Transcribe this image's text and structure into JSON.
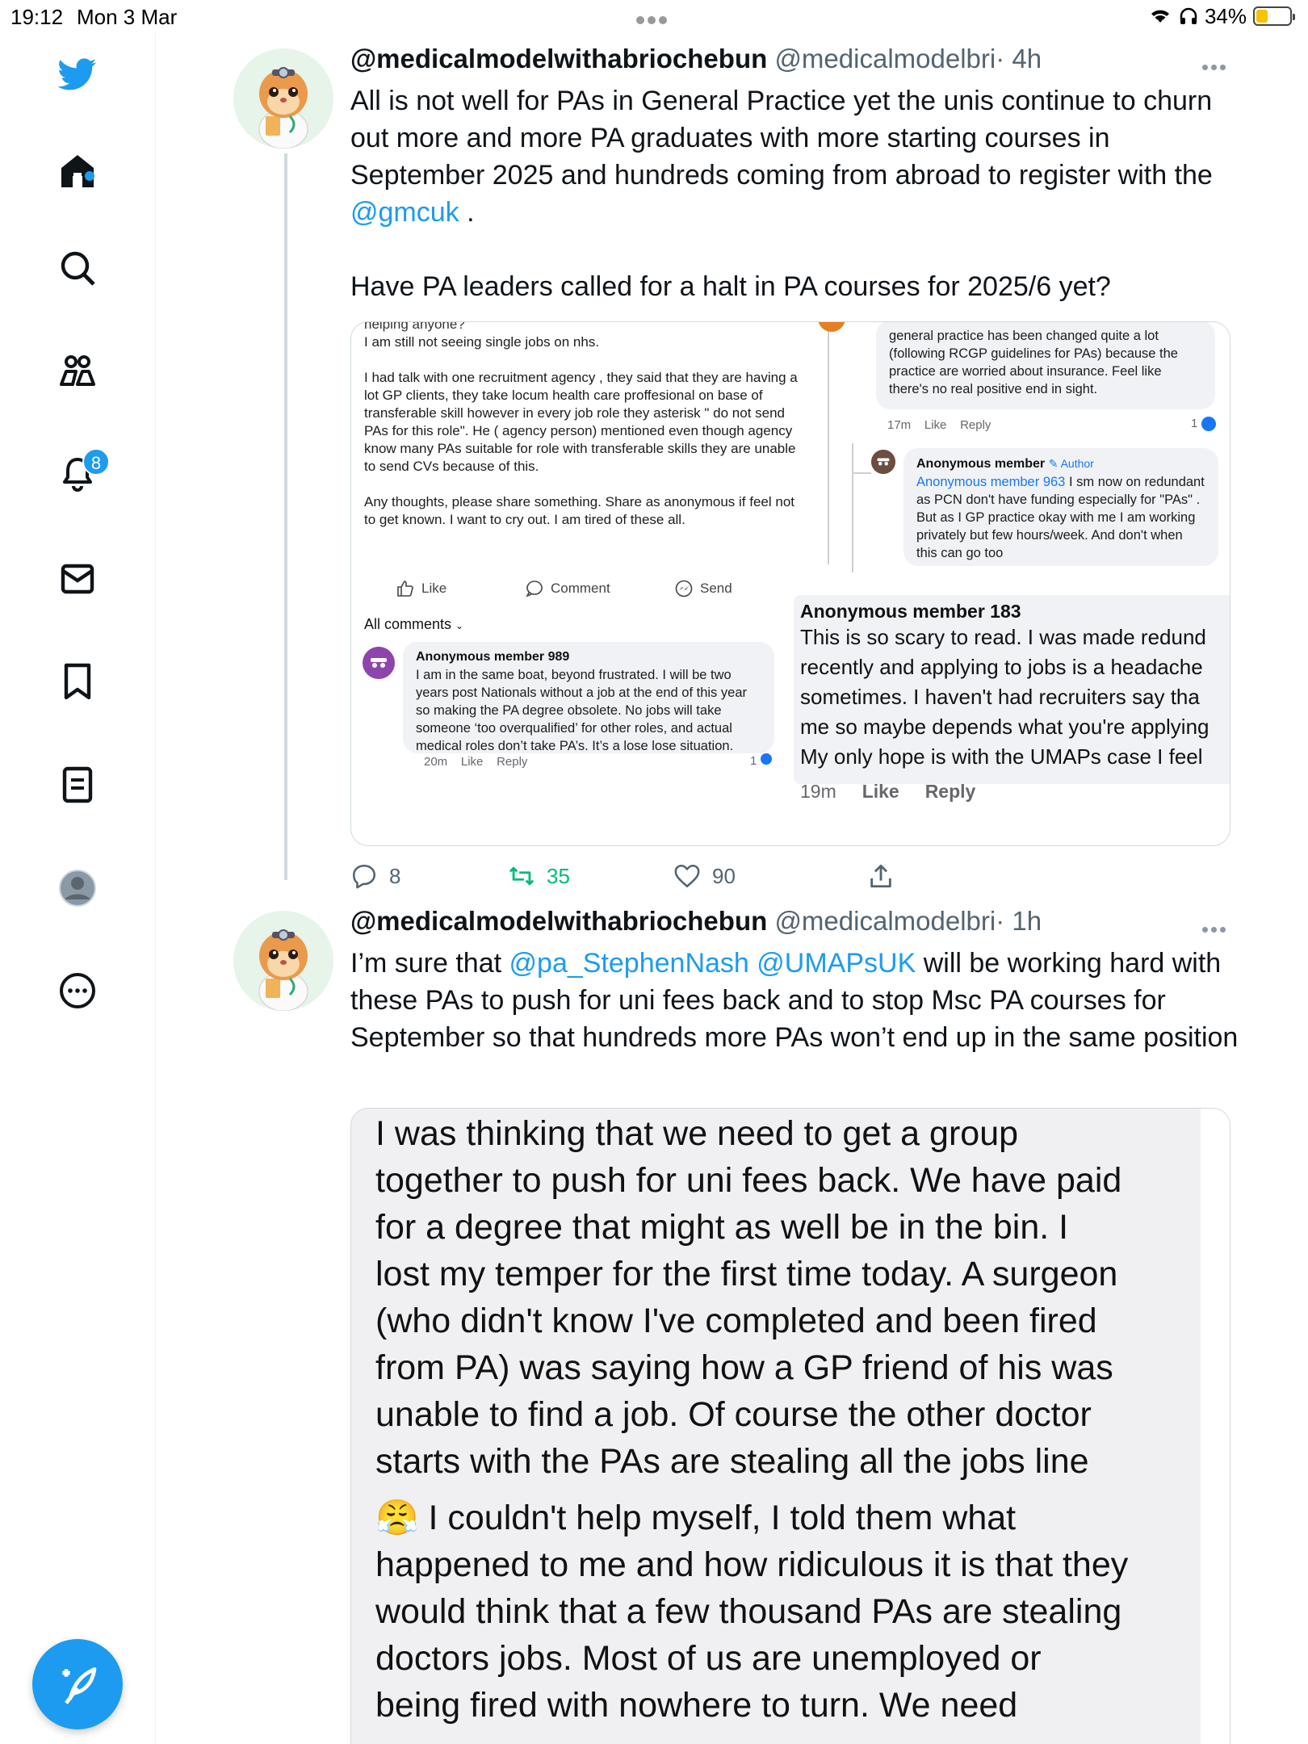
{
  "status_bar": {
    "time": "19:12",
    "date": "Mon 3 Mar",
    "battery": "34%"
  },
  "sidebar": {
    "notifications_count": "8",
    "icons": [
      "twitter-logo-icon",
      "home-icon",
      "search-icon",
      "communities-icon",
      "notifications-icon",
      "messages-icon",
      "bookmarks-icon",
      "lists-icon",
      "profile-icon",
      "more-icon"
    ]
  },
  "colors": {
    "accent": "#1d9bf0",
    "retweet": "#00ba7c"
  },
  "tweets": [
    {
      "name": "@medicalmodelwithabriochebun",
      "handle": "@medicalmodelbri",
      "time": "· 4h",
      "text_1": "All is not well for PAs in General Practice yet the unis continue to churn out more and more PA graduates with more starting courses in September 2025 and hundreds coming from abroad to register with the",
      "mention": "@gmcuk",
      "text_2": ".",
      "text_3": "Have PA leaders called for a halt in PA courses for 2025/6 yet?",
      "replies": "8",
      "retweets": "35",
      "likes": "90",
      "media": {
        "post_cut": "helping anyone?",
        "post_p1": "I am still not seeing single jobs on nhs.",
        "post_p2": "I had talk with one recruitment agency , they said that they are having a lot GP clients, they take locum health care proffesional on base of transferable skill however in every job role they asterisk \" do not send PAs for this role\". He ( agency person) mentioned even though agency know many PAs suitable for role with transferable skills they are unable to send CVs because of this.",
        "post_p3": "Any thoughts, please share something. Share as anonymous if feel not to get known. I want to cry out. I am tired of these all.",
        "like": "Like",
        "comment": "Comment",
        "send": "Send",
        "all_comments": "All comments",
        "c1_name": "Anonymous member 989",
        "c1_text": "I am in the same boat, beyond frustrated. I will be two years post Nationals without a job at the end of this year so making the PA degree obsolete. No jobs will take someone ‘too overqualified’ for other roles, and actual medical roles don’t take PA’s. It’s a lose lose situation.",
        "c1_time": "20m",
        "c1_like": "Like",
        "c1_reply": "Reply",
        "c1_count": "1",
        "c2_text": "general practice has been changed quite a lot (following RCGP guidelines for PAs) because the practice are worried about insurance. Feel like there's no real positive end in sight.",
        "c2_time": "17m",
        "c2_like": "Like",
        "c2_reply": "Reply",
        "c2_count": "1",
        "c3_name": "Anonymous member",
        "c3_author": "Author",
        "c3_mention": "Anonymous member 963",
        "c3_text": "I sm now on redundant as PCN don't have funding especially for \"PAs\" . But as I GP practice okay with me I am working privately but few hours/week. And don't when this can go too",
        "c4_name": "Anonymous member 183",
        "c4_l1": "This is so scary to read. I was made redund",
        "c4_l2": "recently and applying to jobs is a headache",
        "c4_l3": "sometimes. I haven't had recruiters say tha",
        "c4_l4": "me so maybe depends what you're applying",
        "c4_l5": "My only hope is with the UMAPs case I feel",
        "c4_time": "19m",
        "c4_like": "Like",
        "c4_reply": "Reply"
      }
    },
    {
      "name": "@medicalmodelwithabriochebun",
      "handle": "@medicalmodelbri",
      "time": "· 1h",
      "text_1": "I’m sure that",
      "mention_1": "@pa_StephenNash",
      "mention_2": "@UMAPsUK",
      "text_2": "will be working hard with these PAs to push for uni fees back and to stop Msc PA courses for September so that hundreds more PAs won’t end up in the same position",
      "media": {
        "l1": "I was thinking that we need to get a group",
        "l2": "together to push for uni fees back.  We have paid",
        "l3": "for a degree that might as well be in the bin.  I",
        "l4": "lost my temper for the first time today.  A surgeon",
        "l5": "(who didn't know I've completed and been fired",
        "l6": "from PA) was saying how a GP friend of his was",
        "l7": "unable to find a job.  Of course the other doctor",
        "l8": "starts with the PAs are stealing all the jobs line",
        "emoji": "😤",
        "l9": "I couldn't help myself, I told them what",
        "l10": "happened to me and how ridiculous it is that they",
        "l11": "would think that a few thousand PAs are stealing",
        "l12": "doctors jobs.  Most of us are unemployed or",
        "l13": "being fired with nowhere to turn.  We need"
      }
    }
  ]
}
